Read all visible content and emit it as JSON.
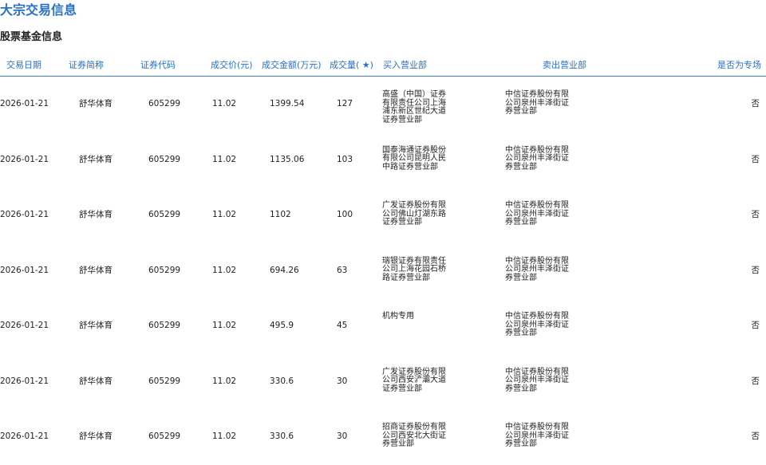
{
  "page": {
    "title": "大宗交易信息",
    "section_title": "股票基金信息"
  },
  "table": {
    "headers": {
      "date": "交易日期",
      "name": "证券简称",
      "code": "证券代码",
      "price": "成交价(元)",
      "amount": "成交金额(万元)",
      "volume": "成交量( ★)",
      "buy": "买入营业部",
      "sell": "卖出营业部",
      "special": "是否为专场"
    },
    "rows": [
      {
        "date": "2026-01-21",
        "name": "舒华体育",
        "code": "605299",
        "price": "11.02",
        "amount": "1399.54",
        "volume": "127",
        "buy": "高盛（中国）证券有限责任公司上海浦东新区世纪大道证券营业部",
        "sell": "中信证券股份有限公司泉州丰泽街证券营业部",
        "special": "否"
      },
      {
        "date": "2026-01-21",
        "name": "舒华体育",
        "code": "605299",
        "price": "11.02",
        "amount": "1135.06",
        "volume": "103",
        "buy": "国泰海通证券股份有限公司昆明人民中路证券营业部",
        "sell": "中信证券股份有限公司泉州丰泽街证券营业部",
        "special": "否"
      },
      {
        "date": "2026-01-21",
        "name": "舒华体育",
        "code": "605299",
        "price": "11.02",
        "amount": "1102",
        "volume": "100",
        "buy": "广发证券股份有限公司佛山灯湖东路证券营业部",
        "sell": "中信证券股份有限公司泉州丰泽街证券营业部",
        "special": "否"
      },
      {
        "date": "2026-01-21",
        "name": "舒华体育",
        "code": "605299",
        "price": "11.02",
        "amount": "694.26",
        "volume": "63",
        "buy": "瑞银证券有限责任公司上海花园石桥路证券营业部",
        "sell": "中信证券股份有限公司泉州丰泽街证券营业部",
        "special": "否"
      },
      {
        "date": "2026-01-21",
        "name": "舒华体育",
        "code": "605299",
        "price": "11.02",
        "amount": "495.9",
        "volume": "45",
        "buy": "机构专用",
        "sell": "中信证券股份有限公司泉州丰泽街证券营业部",
        "special": "否"
      },
      {
        "date": "2026-01-21",
        "name": "舒华体育",
        "code": "605299",
        "price": "11.02",
        "amount": "330.6",
        "volume": "30",
        "buy": "广发证券股份有限公司西安浐灞大道证券营业部",
        "sell": "中信证券股份有限公司泉州丰泽街证券营业部",
        "special": "否"
      },
      {
        "date": "2026-01-21",
        "name": "舒华体育",
        "code": "605299",
        "price": "11.02",
        "amount": "330.6",
        "volume": "30",
        "buy": "招商证券股份有限公司西安北大街证券营业部",
        "sell": "中信证券股份有限公司泉州丰泽街证券营业部",
        "special": "否"
      }
    ]
  }
}
